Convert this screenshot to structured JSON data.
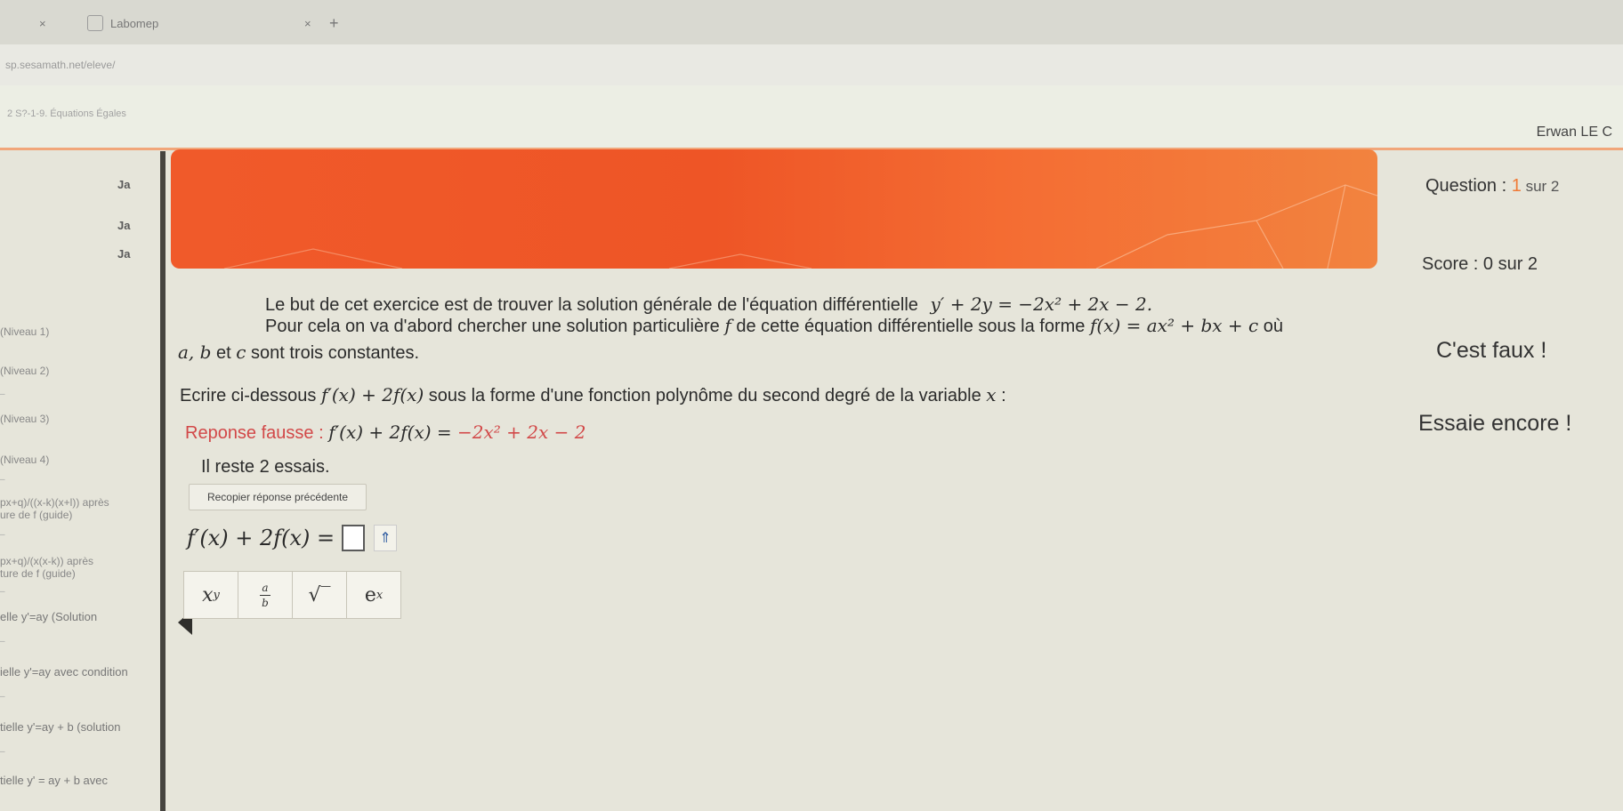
{
  "browser": {
    "tab1_close": "×",
    "tab1_title": "Labomep",
    "tab2_close": "×",
    "new_tab": "+",
    "url": "sp.sesamath.net/eleve/",
    "breadcrumb": "2 S?-1-9. Équations Égales"
  },
  "header": {
    "user_name": "Erwan LE C"
  },
  "sidebar": {
    "icons": [
      "Ja",
      "Ja",
      "Ja"
    ],
    "levels": [
      "(Niveau 1)",
      "(Niveau 2)",
      "(Niveau 3)",
      "(Niveau 4)"
    ],
    "items": [
      {
        "line1": "px+q)/((x-k)(x+l)) après",
        "line2": "ure de f (guide)"
      },
      {
        "line1": "px+q)/(x(x-k)) après",
        "line2": "ture de f (guide)"
      },
      {
        "line1": "elle y'=ay (Solution",
        "line2": ""
      },
      {
        "line1": "ielle y'=ay avec condition",
        "line2": ""
      },
      {
        "line1": "tielle y'=ay + b (solution",
        "line2": ""
      },
      {
        "line1": "tielle y' = ay + b avec",
        "line2": ""
      }
    ]
  },
  "status": {
    "question_label": "Question : ",
    "question_current": "1",
    "question_total": " sur 2",
    "score_label": "Score : 0 sur 2",
    "verdict": "C'est faux !",
    "encourage": "Essaie encore !"
  },
  "exercise": {
    "intro": "Le but de cet exercice est de trouver la solution générale de l'équation différentielle",
    "equation": "y′ + 2y = −2x² + 2x − 2.",
    "step_text": "Pour cela on va d'abord chercher une solution particulière ",
    "step_f": "f",
    "step_text2": " de cette équation différentielle sous la forme ",
    "step_form": "f(x) = ax² + bx + c",
    "step_text3": " où",
    "constants_vars": "a, b",
    "constants_et": " et ",
    "constants_c": "c",
    "constants_text": " sont trois constantes.",
    "instruction": "Ecrire ci-dessous ",
    "instruction_expr": "f′(x) + 2f(x)",
    "instruction_text2": " sous la forme d'une fonction polynôme du second degré de la variable ",
    "instruction_var": "x",
    "instruction_end": " :",
    "wrong_label": "Reponse fausse : ",
    "wrong_lhs": "f′(x) + 2f(x) = ",
    "wrong_rhs": "−2x² + 2x − 2",
    "attempts_left": "Il reste 2 essais.",
    "copy_button": "Recopier réponse précédente",
    "answer_prefix": "f′(x) + 2f(x) =",
    "submit_symbol": "⇑"
  },
  "keyboard": {
    "power_base": "x",
    "power_exp": "y",
    "frac_num": "a",
    "frac_den": "b",
    "sqrt": "√‾",
    "exp_base": "e",
    "exp_exp": "x"
  },
  "colors": {
    "banner": "#f05a2a",
    "accent_wrong": "#d24848",
    "question_current": "#f07a36",
    "background": "#e6e5da"
  }
}
